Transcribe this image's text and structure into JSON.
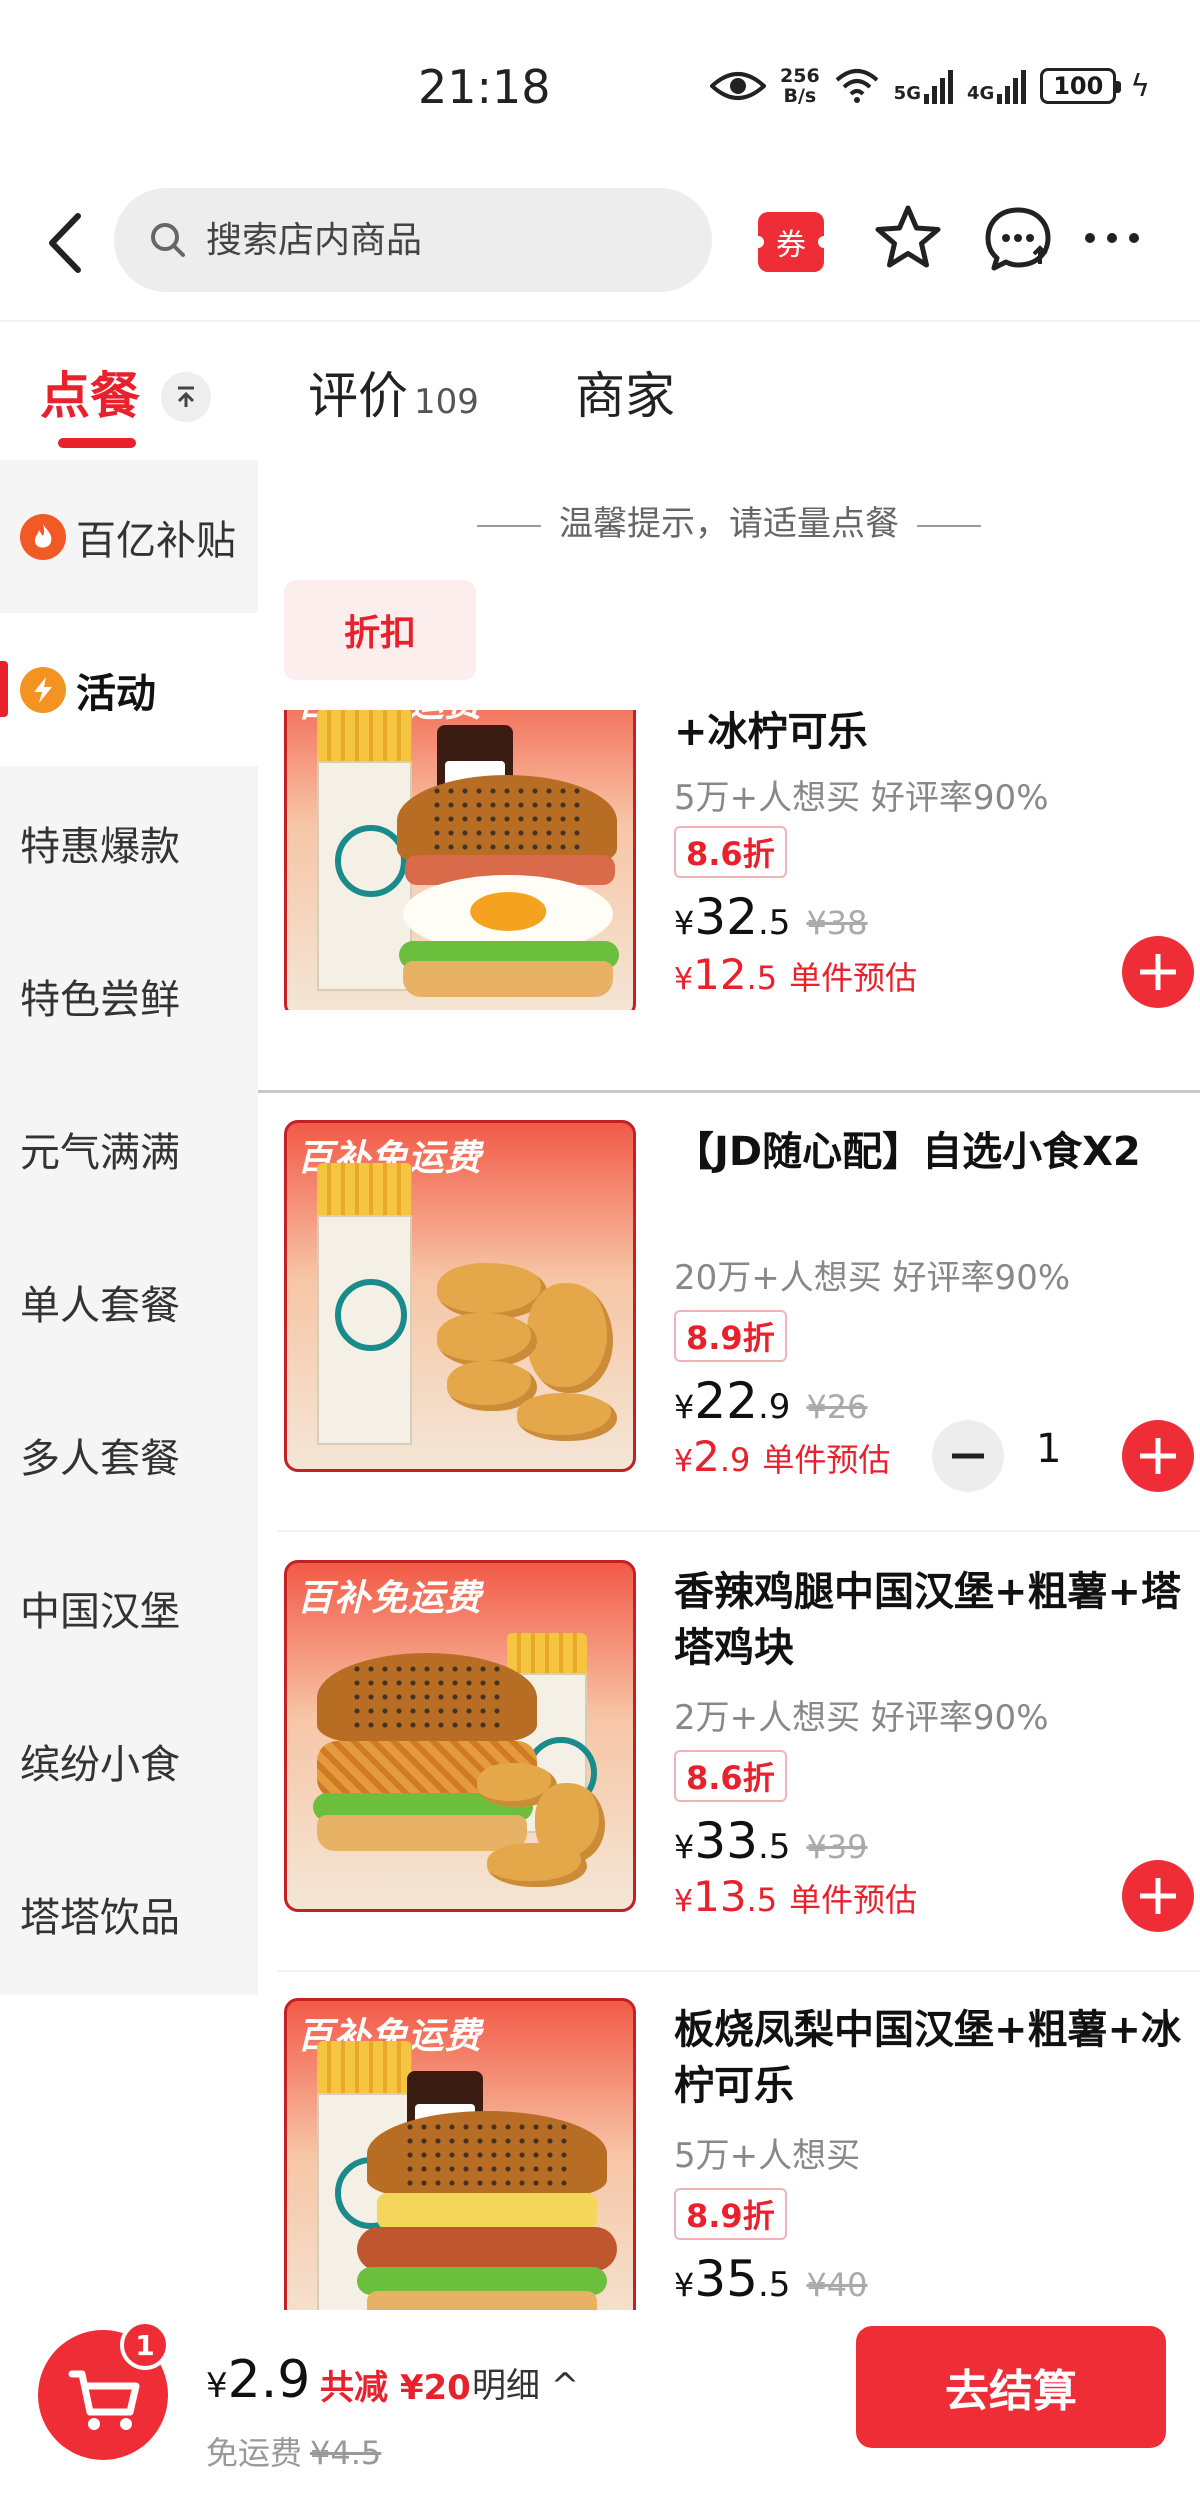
{
  "status_bar": {
    "time": "21:18",
    "net_speed_top": "256",
    "net_speed_bottom": "B/s",
    "sig1_label": "5G",
    "sig2_label": "4G",
    "battery": "100"
  },
  "header": {
    "search_placeholder": "搜索店内商品",
    "coupon_label": "券"
  },
  "tabs": {
    "order": "点餐",
    "reviews": "评价",
    "reviews_count": "109",
    "merchant": "商家"
  },
  "sidebar": {
    "items": [
      {
        "label": "百亿补贴"
      },
      {
        "label": "活动"
      },
      {
        "label": "特惠爆款"
      },
      {
        "label": "特色尝鲜"
      },
      {
        "label": "元气满满"
      },
      {
        "label": "单人套餐"
      },
      {
        "label": "多人套餐"
      },
      {
        "label": "中国汉堡"
      },
      {
        "label": "缤纷小食"
      },
      {
        "label": "塔塔饮品"
      }
    ]
  },
  "content": {
    "tip": "温馨提示，请适量点餐",
    "filter_chip": "折扣",
    "thumb_tag": "百补免运费",
    "products": [
      {
        "title": "+冰柠可乐",
        "sub": "5万+人想买  好评率90%",
        "discount": "8.6折",
        "price_int": "32",
        "price_dec": ".5",
        "price_orig": "¥38",
        "est_int": "12",
        "est_dec": ".5",
        "est_label": "单件预估"
      },
      {
        "title": "【JD随心配】自选小食X2",
        "sub": "20万+人想买  好评率90%",
        "discount": "8.9折",
        "price_int": "22",
        "price_dec": ".9",
        "price_orig": "¥26",
        "est_int": "2",
        "est_dec": ".9",
        "est_label": "单件预估",
        "quantity": "1"
      },
      {
        "title": "香辣鸡腿中国汉堡+粗薯+塔塔鸡块",
        "sub": "2万+人想买  好评率90%",
        "discount": "8.6折",
        "price_int": "33",
        "price_dec": ".5",
        "price_orig": "¥39",
        "est_int": "13",
        "est_dec": ".5",
        "est_label": "单件预估"
      },
      {
        "title": "板烧凤梨中国汉堡+粗薯+冰柠可乐",
        "sub": "5万+人想买",
        "discount": "8.9折",
        "price_int": "35",
        "price_dec": ".5",
        "price_orig": "¥40"
      }
    ]
  },
  "cart": {
    "badge": "1",
    "yen": "¥",
    "total": "2.9",
    "saving": "共减 ¥20",
    "detail": "明细 ^",
    "delivery_label": "免运费",
    "delivery_orig": "¥4.5",
    "checkout": "去结算"
  },
  "colors": {
    "brand_red": "#ef2d37",
    "sidebar_bg": "#f5f5f5"
  }
}
